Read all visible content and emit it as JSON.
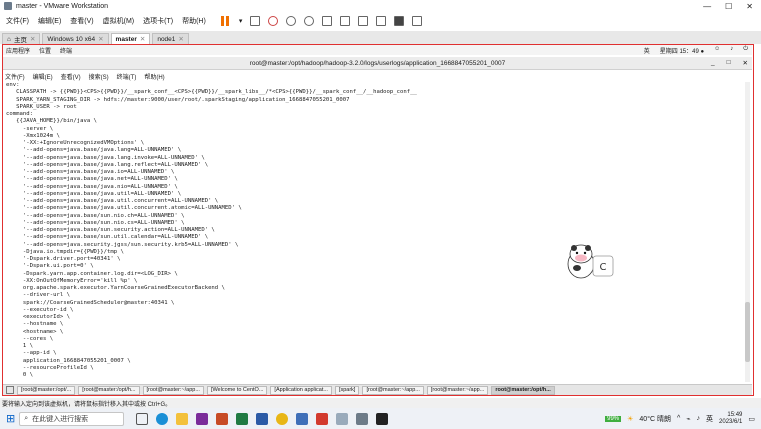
{
  "vmware": {
    "title": "master - VMware Workstation",
    "menu": [
      "文件(F)",
      "编辑(E)",
      "查看(V)",
      "虚拟机(M)",
      "选项卡(T)",
      "帮助(H)"
    ],
    "tabs": [
      {
        "label": "主页",
        "active": false
      },
      {
        "label": "Windows 10 x64",
        "active": false
      },
      {
        "label": "master",
        "active": true
      },
      {
        "label": "node1",
        "active": false
      }
    ]
  },
  "gnome": {
    "apps": "应用程序",
    "places": "位置",
    "terminal": "终端",
    "lang": "英",
    "datetime": "星期四 15：49 ●"
  },
  "terminal": {
    "title": "root@master:/opt/hadoop/hadoop-3.2.0/logs/userlogs/application_1668847055201_0007",
    "menu": [
      "文件(F)",
      "编辑(E)",
      "查看(V)",
      "搜索(S)",
      "终端(T)",
      "帮助(H)"
    ],
    "lines": [
      "env:",
      "   CLASSPATH -> {{PWD}}<CPS>{{PWD}}/__spark_conf__<CPS>{{PWD}}/__spark_libs__/*<CPS>{{PWD}}/__spark_conf__/__hadoop_conf__",
      "   SPARK_YARN_STAGING_DIR -> hdfs://master:9000/user/root/.sparkStaging/application_1668847055201_0007",
      "   SPARK_USER -> root",
      "",
      "command:",
      "   {{JAVA_HOME}}/bin/java \\",
      "     -server \\",
      "     -Xmx1024m \\",
      "     '-XX:+IgnoreUnrecognizedVMOptions' \\",
      "     '--add-opens=java.base/java.lang=ALL-UNNAMED' \\",
      "     '--add-opens=java.base/java.lang.invoke=ALL-UNNAMED' \\",
      "     '--add-opens=java.base/java.lang.reflect=ALL-UNNAMED' \\",
      "     '--add-opens=java.base/java.io=ALL-UNNAMED' \\",
      "     '--add-opens=java.base/java.net=ALL-UNNAMED' \\",
      "     '--add-opens=java.base/java.nio=ALL-UNNAMED' \\",
      "     '--add-opens=java.base/java.util=ALL-UNNAMED' \\",
      "     '--add-opens=java.base/java.util.concurrent=ALL-UNNAMED' \\",
      "     '--add-opens=java.base/java.util.concurrent.atomic=ALL-UNNAMED' \\",
      "     '--add-opens=java.base/sun.nio.ch=ALL-UNNAMED' \\",
      "     '--add-opens=java.base/sun.nio.cs=ALL-UNNAMED' \\",
      "     '--add-opens=java.base/sun.security.action=ALL-UNNAMED' \\",
      "     '--add-opens=java.base/sun.util.calendar=ALL-UNNAMED' \\",
      "     '--add-opens=java.security.jgss/sun.security.krb5=ALL-UNNAMED' \\",
      "     -Djava.io.tmpdir={{PWD}}/tmp \\",
      "     '-Dspark.driver.port=40341' \\",
      "     '-Dspark.ui.port=0' \\",
      "     -Dspark.yarn.app.container.log.dir=<LOG_DIR> \\",
      "     -XX:OnOutOfMemoryError='kill %p' \\",
      "     org.apache.spark.executor.YarnCoarseGrainedExecutorBackend \\",
      "     --driver-url \\",
      "     spark://CoarseGrainedScheduler@master:40341 \\",
      "     --executor-id \\",
      "     <executorId> \\",
      "     --hostname \\",
      "     <hostname> \\",
      "     --cores \\",
      "     1 \\",
      "     --app-id \\",
      "     application_1668847055201_0007 \\",
      "     --resourceProfileId \\",
      "     0 \\"
    ]
  },
  "guest_taskbar": [
    {
      "label": "[root@master:/opt/...",
      "active": false
    },
    {
      "label": "[root@master:/opt/h...",
      "active": false
    },
    {
      "label": "[root@master:~/app...",
      "active": false
    },
    {
      "label": "[Welcome to CentO...",
      "active": false
    },
    {
      "label": "[Application applicat...",
      "active": false
    },
    {
      "label": "[spark]",
      "active": false
    },
    {
      "label": "[root@master:~/app...",
      "active": false
    },
    {
      "label": "[root@master:~/app...",
      "active": false
    },
    {
      "label": "root@master:/opt/h...",
      "active": true
    }
  ],
  "status_bar": "要将输入定向到该虚拟机，请将鼠标指针移入其中或按 Ctrl+G。",
  "windows": {
    "search_placeholder": "在此键入进行搜索",
    "weather": "40°C 晴朗",
    "lang": "英",
    "time": "15:49",
    "date": "2023/6/1",
    "battery": "99%"
  }
}
